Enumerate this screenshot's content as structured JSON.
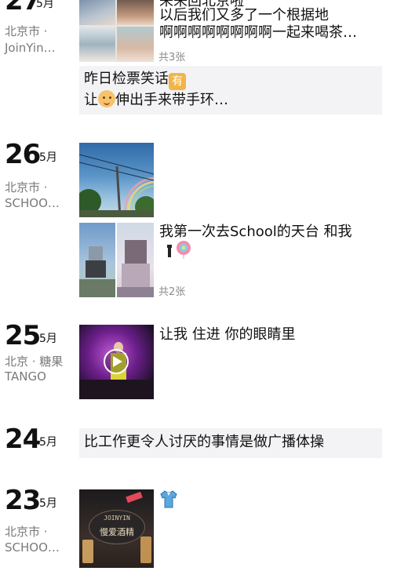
{
  "entries": {
    "e27": {
      "day": "27",
      "month": "5月",
      "location": [
        "北京市 ·",
        "JoinYin…"
      ],
      "caption_lines": [
        "来来回北京啦",
        "以后我们又多了一个根据地",
        "啊啊啊啊啊啊啊啊一起来喝茶…"
      ],
      "count": "共3张"
    },
    "e27b": {
      "text_line1": "昨日检票笑话",
      "text_badge": "有",
      "text_line2_a": "让",
      "text_line2_b": "伸出手来带手环…"
    },
    "e26": {
      "day": "26",
      "month": "5月",
      "location": [
        "北京市 ·",
        "SCHOO…"
      ],
      "caption_line1": "我第一次去School的天台 和我",
      "count": "共2张"
    },
    "e25": {
      "day": "25",
      "month": "5月",
      "location": [
        "北京 · 糖果",
        "TANGO"
      ],
      "caption": "让我 住进 你的眼睛里"
    },
    "e24": {
      "day": "24",
      "month": "5月",
      "text": "比工作更令人讨厌的事情是做广播体操"
    },
    "e23": {
      "day": "23",
      "month": "5月",
      "location": [
        "北京市 ·",
        "SCHOO…"
      ],
      "photo_text": [
        "JOINYIN",
        "慢爱酒精"
      ]
    }
  },
  "colors": {
    "text": "#111111",
    "muted": "#7a7a7a",
    "textbox_bg": "#f3f3f5"
  },
  "icons": [
    "play-icon",
    "lollipop-icon",
    "shirt-icon",
    "smiley-icon"
  ]
}
